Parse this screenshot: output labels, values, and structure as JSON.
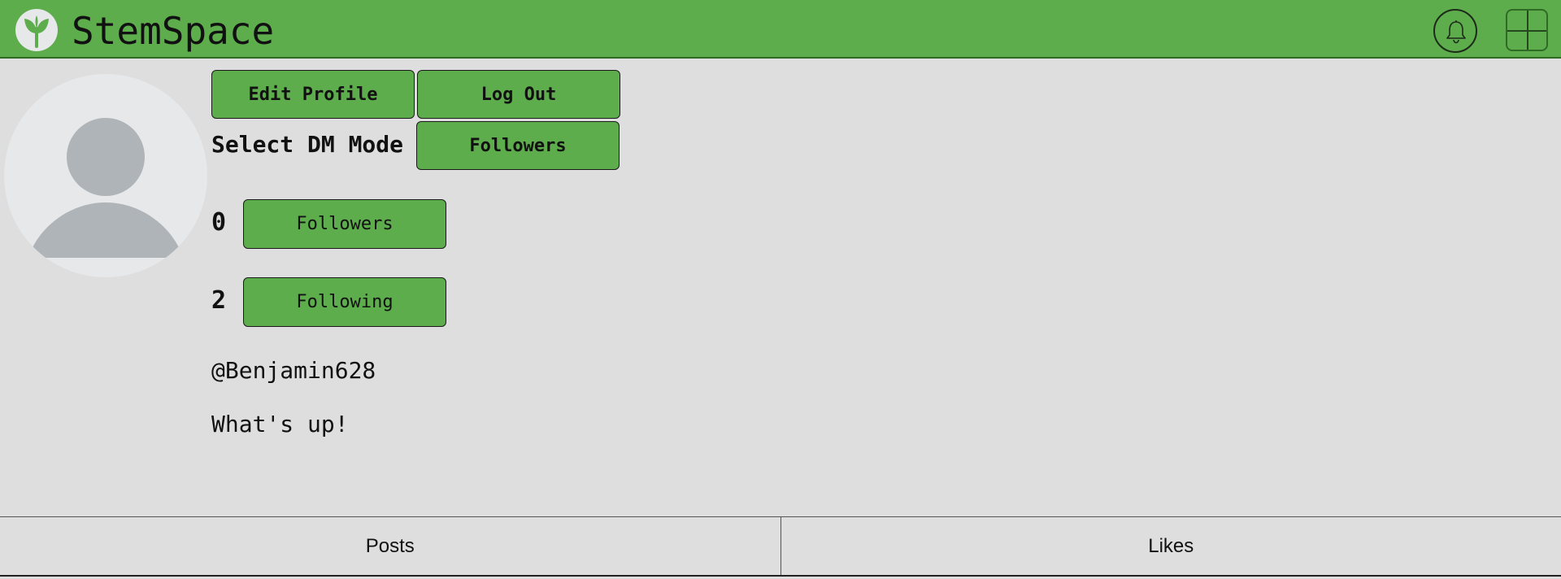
{
  "header": {
    "brand": "StemSpace",
    "logo_icon": "sprout-logo-icon",
    "notifications_icon": "bell-icon",
    "create_icon": "plus-icon",
    "bar_color": "#5ead4d"
  },
  "profile": {
    "avatar_icon": "default-user-avatar-icon",
    "edit_profile_label": "Edit Profile",
    "log_out_label": "Log Out",
    "dm_mode_label": "Select DM Mode",
    "dm_mode_value": "Followers",
    "followers_count": "0",
    "followers_label": "Followers",
    "following_count": "2",
    "following_label": "Following",
    "handle": "@Benjamin628",
    "bio": "What's up!"
  },
  "tabs": [
    {
      "label": "Posts"
    },
    {
      "label": "Likes"
    }
  ]
}
